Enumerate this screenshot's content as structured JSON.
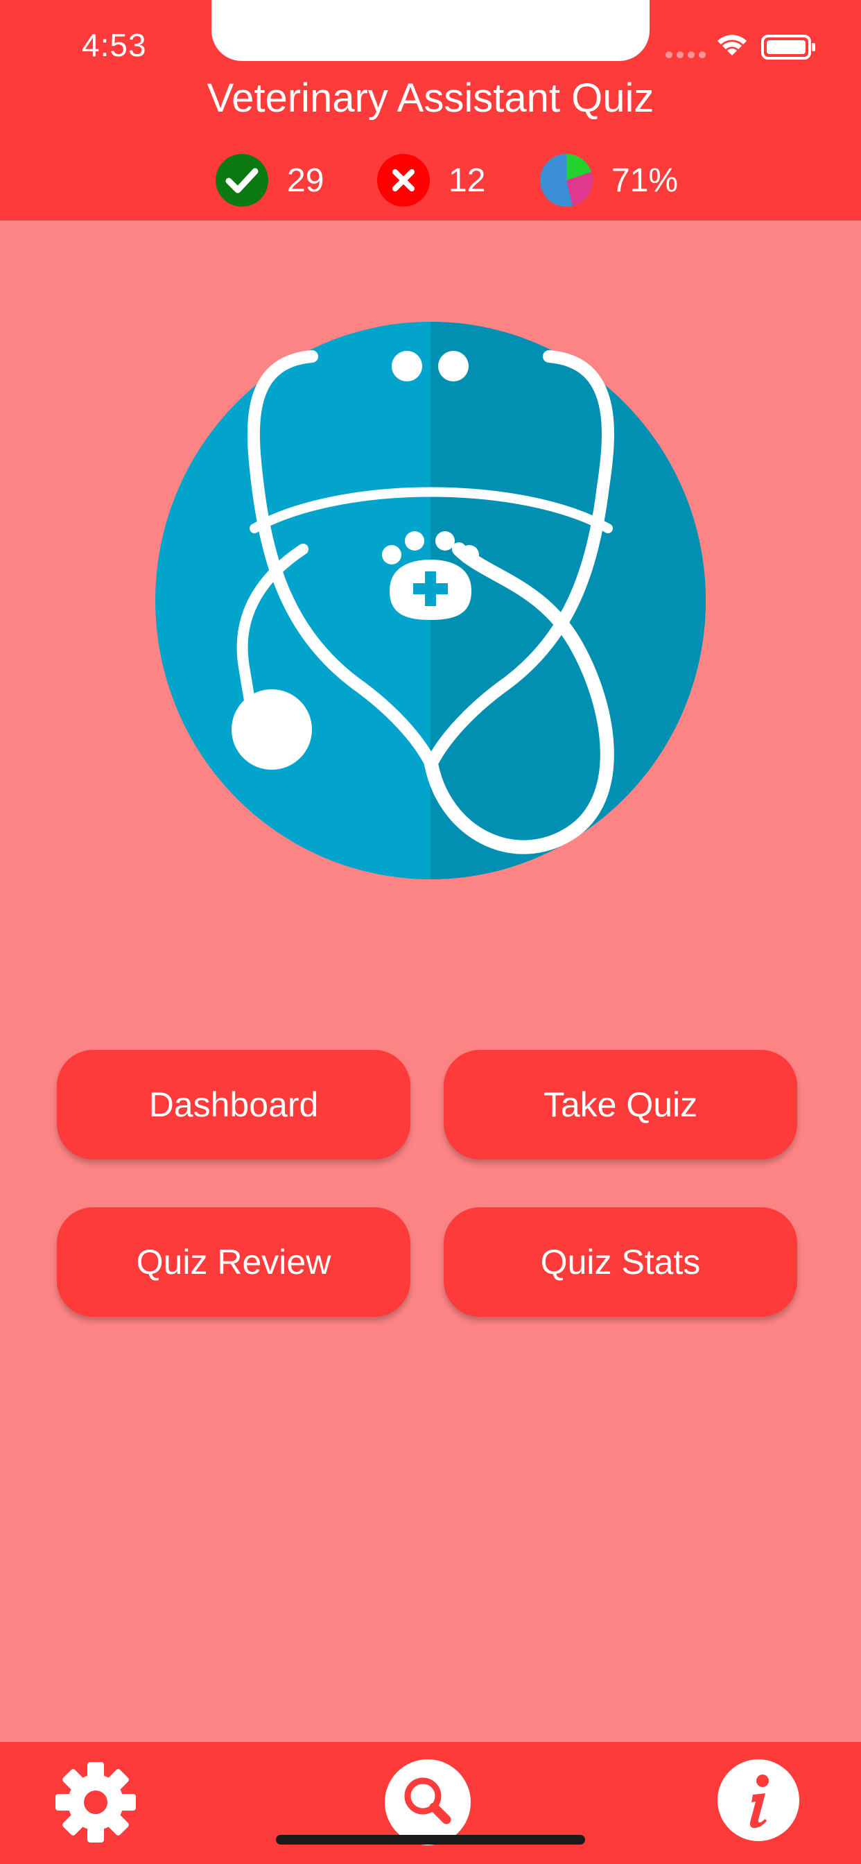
{
  "status_bar": {
    "time": "4:53"
  },
  "header": {
    "title": "Veterinary Assistant Quiz"
  },
  "stats": {
    "correct": "29",
    "incorrect": "12",
    "score": "71%"
  },
  "buttons": {
    "dashboard": "Dashboard",
    "take_quiz": "Take Quiz",
    "quiz_review": "Quiz Review",
    "quiz_stats": "Quiz Stats"
  },
  "icons": {
    "logo": "stethoscope-paw-icon",
    "correct": "checkmark-icon",
    "incorrect": "x-icon",
    "score": "pie-chart-icon",
    "settings": "gear-icon",
    "search": "search-icon",
    "info": "info-icon"
  },
  "colors": {
    "primary": "#fd3b3b",
    "background": "#fd8484",
    "logo_blue": "#02a4cc",
    "logo_blue_dark": "#018fb2",
    "correct_green": "#0a7a10",
    "incorrect_red": "#ff0000"
  }
}
